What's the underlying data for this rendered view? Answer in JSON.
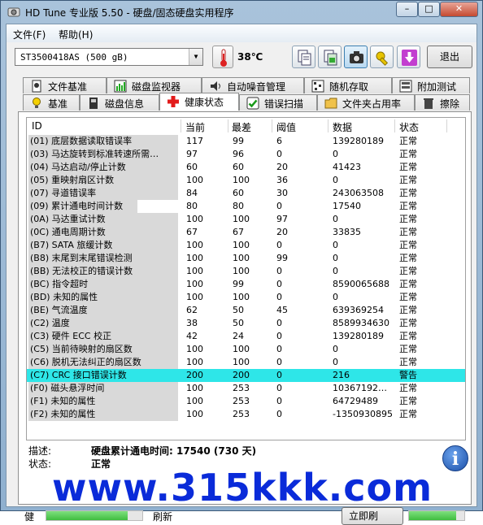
{
  "window": {
    "title": "HD Tune 专业版 5.50 - 硬盘/固态硬盘实用程序",
    "min_label": "–",
    "max_label": "□",
    "close_label": "✕"
  },
  "menu": [
    "文件(F)",
    "帮助(H)"
  ],
  "toolbar": {
    "drive": "ST3500418AS (500 gB)",
    "temperature": "38℃",
    "exit_label": "退出",
    "icons": [
      "copy-text-icon",
      "copy-screenshot-icon",
      "camera-icon",
      "options-icon",
      "save-icon"
    ]
  },
  "tabs_top": [
    "文件基准",
    "磁盘监视器",
    "自动噪音管理",
    "随机存取",
    "附加测试"
  ],
  "tabs_bottom": [
    "基准",
    "磁盘信息",
    "健康状态",
    "错误扫描",
    "文件夹占用率",
    "擦除"
  ],
  "active_tab": "健康状态",
  "table": {
    "columns": [
      "ID",
      "当前",
      "最差",
      "阈值",
      "数据",
      "状态"
    ],
    "rows": [
      {
        "id": "(01) 底层数据读取错误率",
        "cur": "117",
        "worst": "99",
        "thr": "6",
        "data": "139280189",
        "status": "正常"
      },
      {
        "id": "(03) 马达旋转到标准转速所需…",
        "cur": "97",
        "worst": "96",
        "thr": "0",
        "data": "0",
        "status": "正常"
      },
      {
        "id": "(04) 马达启动/停止计数",
        "cur": "60",
        "worst": "60",
        "thr": "20",
        "data": "41423",
        "status": "正常"
      },
      {
        "id": "(05) 重映射扇区计数",
        "cur": "100",
        "worst": "100",
        "thr": "36",
        "data": "0",
        "status": "正常"
      },
      {
        "id": "(07) 寻道错误率",
        "cur": "84",
        "worst": "60",
        "thr": "30",
        "data": "243063508",
        "status": "正常"
      },
      {
        "id": "(09) 累计通电时间计数",
        "cur": "80",
        "worst": "80",
        "thr": "0",
        "data": "17540",
        "status": "正常"
      },
      {
        "id": "(0A) 马达重试计数",
        "cur": "100",
        "worst": "100",
        "thr": "97",
        "data": "0",
        "status": "正常"
      },
      {
        "id": "(0C) 通电周期计数",
        "cur": "67",
        "worst": "67",
        "thr": "20",
        "data": "33835",
        "status": "正常"
      },
      {
        "id": "(B7) SATA 旅缓计数",
        "cur": "100",
        "worst": "100",
        "thr": "0",
        "data": "0",
        "status": "正常"
      },
      {
        "id": "(B8) 末尾到末尾错误检测",
        "cur": "100",
        "worst": "100",
        "thr": "99",
        "data": "0",
        "status": "正常"
      },
      {
        "id": "(BB) 无法校正的错误计数",
        "cur": "100",
        "worst": "100",
        "thr": "0",
        "data": "0",
        "status": "正常"
      },
      {
        "id": "(BC) 指令超时",
        "cur": "100",
        "worst": "99",
        "thr": "0",
        "data": "8590065688",
        "status": "正常"
      },
      {
        "id": "(BD) 未知的属性",
        "cur": "100",
        "worst": "100",
        "thr": "0",
        "data": "0",
        "status": "正常"
      },
      {
        "id": "(BE) 气流温度",
        "cur": "62",
        "worst": "50",
        "thr": "45",
        "data": "639369254",
        "status": "正常"
      },
      {
        "id": "(C2) 温度",
        "cur": "38",
        "worst": "50",
        "thr": "0",
        "data": "8589934630",
        "status": "正常"
      },
      {
        "id": "(C3) 硬件 ECC 校正",
        "cur": "42",
        "worst": "24",
        "thr": "0",
        "data": "139280189",
        "status": "正常"
      },
      {
        "id": "(C5) 当前待映射的扇区数",
        "cur": "100",
        "worst": "100",
        "thr": "0",
        "data": "0",
        "status": "正常"
      },
      {
        "id": "(C6) 脱机无法纠正的扇区数",
        "cur": "100",
        "worst": "100",
        "thr": "0",
        "data": "0",
        "status": "正常"
      },
      {
        "id": "(C7) CRC 接口错误计数",
        "cur": "200",
        "worst": "200",
        "thr": "0",
        "data": "216",
        "status": "警告"
      },
      {
        "id": "(F0) 磁头悬浮时间",
        "cur": "100",
        "worst": "253",
        "thr": "0",
        "data": "10367192…",
        "status": "正常"
      },
      {
        "id": "(F1) 未知的属性",
        "cur": "100",
        "worst": "253",
        "thr": "0",
        "data": "64729489",
        "status": "正常"
      },
      {
        "id": "(F2) 未知的属性",
        "cur": "100",
        "worst": "253",
        "thr": "0",
        "data": "-1350930895",
        "status": "正常"
      }
    ],
    "highlight_color": "#2ee6e8"
  },
  "details": {
    "desc_label": "描述:",
    "desc_value": "硬盘累计通电时间: 17540 (730 天)",
    "status_label": "状态:",
    "status_value": "正常"
  },
  "footer": {
    "left_text": "健",
    "refresh_text": "刷新",
    "button_label": "立即刷",
    "progress_left": 0.85,
    "progress_right": 0.85
  },
  "watermark": "www.315kkk.com"
}
